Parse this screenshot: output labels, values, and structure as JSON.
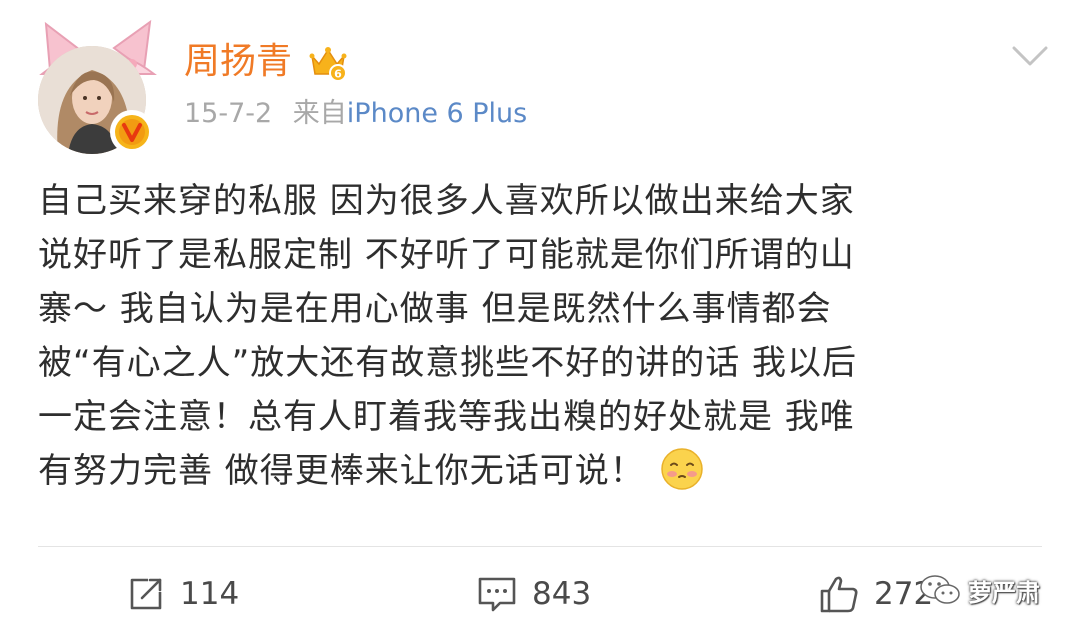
{
  "user": {
    "name": "周扬青",
    "avatar_icon": "profile-photo",
    "badge_icon": "verified-v-icon",
    "level_icon": "crown-icon"
  },
  "post": {
    "date": "15-7-2",
    "source_prefix": "来自",
    "source": "iPhone 6 Plus",
    "lines": [
      "自己买来穿的私服 因为很多人喜欢所以做出来给大家",
      "说好听了是私服定制 不好听了可能就是你们所谓的山",
      "寨～ 我自认为是在用心做事 但是既然什么事情都会",
      "被“有心之人”放大还有故意挑些不好的讲的话 我以后",
      "一定会注意！总有人盯着我等我出糗的好处就是 我唯",
      "有努力完善 做得更棒来让你无话可说！"
    ],
    "emoji": "shy-face-emoji"
  },
  "actions": {
    "repost_count": "114",
    "comment_count": "843",
    "like_count": "272"
  },
  "watermark": {
    "text": "萝严肃",
    "icon": "wechat-icon"
  },
  "colors": {
    "username": "#f07a26",
    "source_link": "#5b89c7",
    "meta": "#a8a8a8",
    "body": "#2e2e2e"
  }
}
